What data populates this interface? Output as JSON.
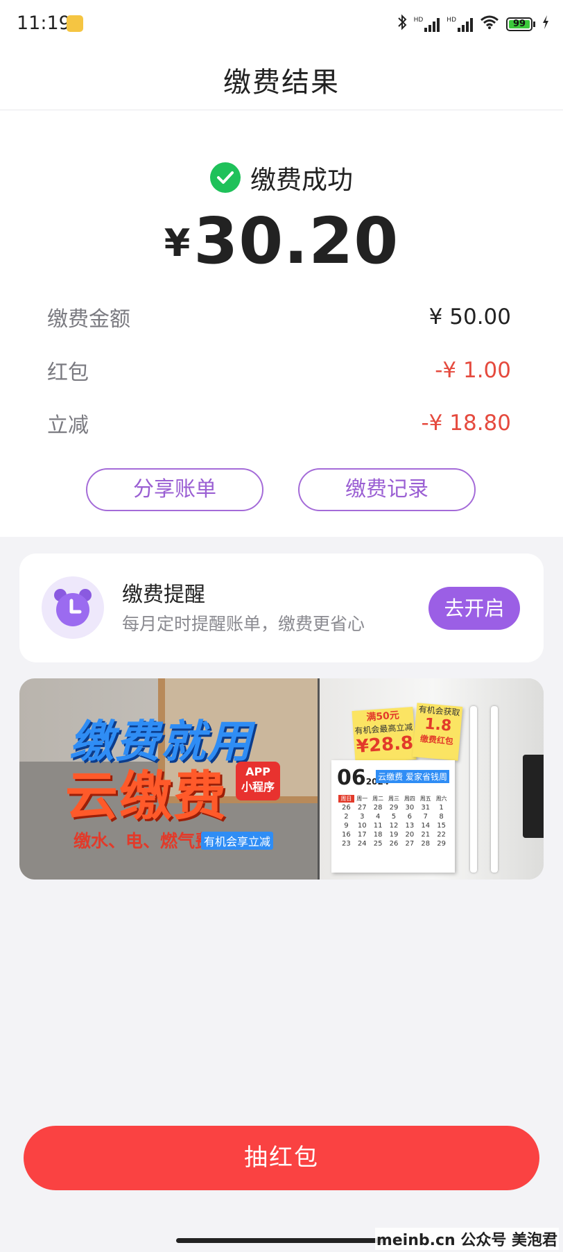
{
  "status_bar": {
    "time": "11:19",
    "signal1_label": "HD",
    "signal2_label": "HD",
    "battery_level": "99"
  },
  "nav": {
    "title": "缴费结果"
  },
  "result": {
    "status_text": "缴费成功",
    "currency": "¥",
    "amount": "30.20",
    "details": [
      {
        "label": "缴费金额",
        "value": "¥ 50.00",
        "color": "#222222"
      },
      {
        "label": "红包",
        "value": "-¥ 1.00",
        "color": "#e54a3e"
      },
      {
        "label": "立减",
        "value": "-¥ 18.80",
        "color": "#e54a3e"
      }
    ],
    "share_button": "分享账单",
    "history_button": "缴费记录"
  },
  "reminder": {
    "title": "缴费提醒",
    "subtitle": "每月定时提醒账单，缴费更省心",
    "button": "去开启"
  },
  "banner": {
    "headline1": "缴费就用",
    "headline2": "云缴费",
    "badge_line1": "APP",
    "badge_line2": "小程序",
    "subline": "缴水、电、燃气费",
    "subline_tag": "有机会享立减",
    "note1_line1": "满50元",
    "note1_line2": "有机会最高立减",
    "note1_amount": "¥28.8",
    "note2_line1": "有机会获取",
    "note2_amount": "1.8",
    "note2_line2": "缴费红包",
    "calendar_month": "06",
    "calendar_year": "2024",
    "calendar_tag": "云缴费 爱家省钱周",
    "calendar_headers": [
      "周日",
      "周一",
      "周二",
      "周三",
      "周四",
      "周五",
      "周六"
    ],
    "calendar_days": [
      "26",
      "27",
      "28",
      "29",
      "30",
      "31",
      "1",
      "2",
      "3",
      "4",
      "5",
      "6",
      "7",
      "8",
      "9",
      "10",
      "11",
      "12",
      "13",
      "14",
      "15",
      "16",
      "17",
      "18",
      "19",
      "20",
      "21",
      "22",
      "23",
      "24",
      "25",
      "26",
      "27",
      "28",
      "29"
    ]
  },
  "bottom": {
    "draw_button": "抽红包",
    "watermark": "meinb.cn 公众号 美泡君"
  },
  "colors": {
    "primary_purple": "#9b5fe5",
    "success_green": "#1fc15a",
    "discount_red": "#e54a3e",
    "cta_red": "#fa4242"
  }
}
